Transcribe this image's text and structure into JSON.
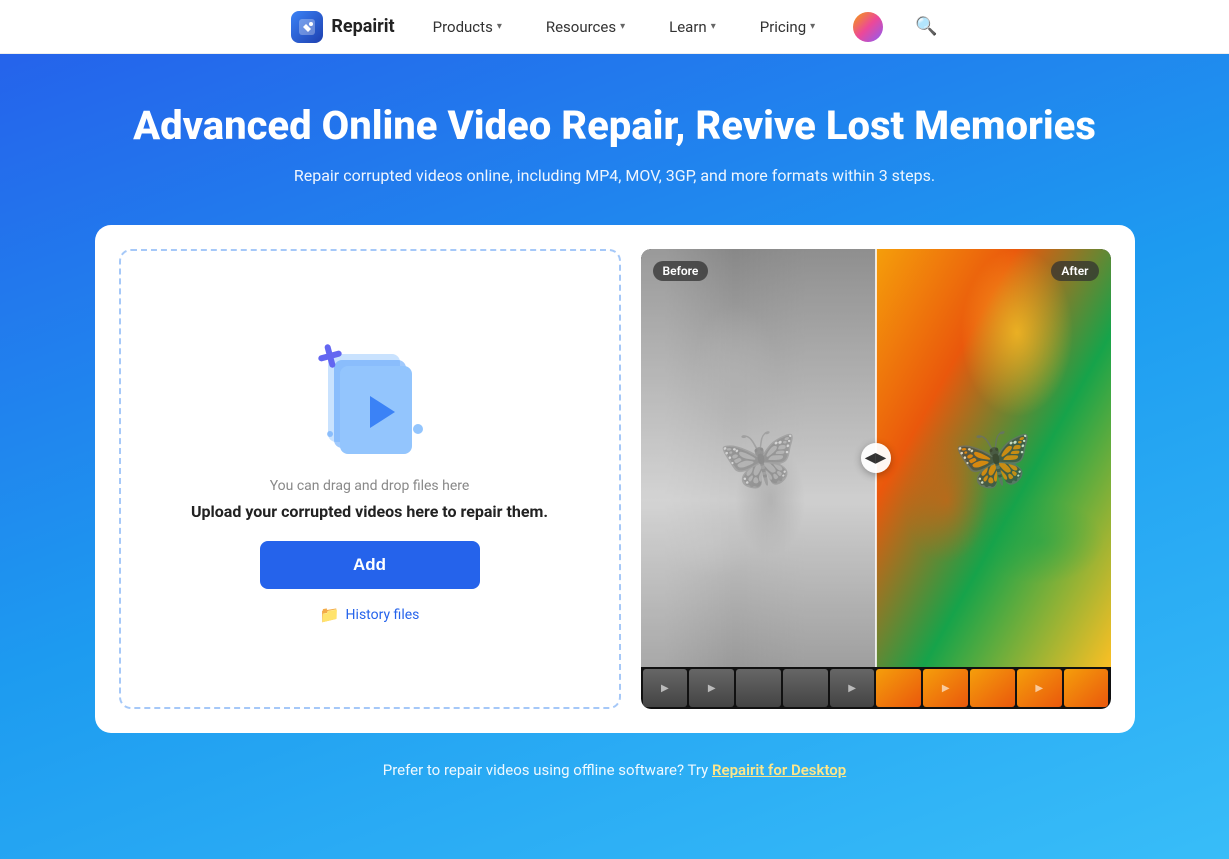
{
  "navbar": {
    "logo_text": "Repairit",
    "products_label": "Products",
    "resources_label": "Resources",
    "learn_label": "Learn",
    "pricing_label": "Pricing"
  },
  "hero": {
    "title": "Advanced Online Video Repair, Revive Lost Memories",
    "subtitle": "Repair corrupted videos online, including MP4, MOV, 3GP, and more formats within 3 steps."
  },
  "upload": {
    "drag_text": "You can drag and drop files here",
    "label": "Upload your corrupted videos here to repair them.",
    "add_button": "Add",
    "history_link": "History files"
  },
  "preview": {
    "badge_before": "Before",
    "badge_after": "After"
  },
  "footer": {
    "text": "Prefer to repair videos using offline software? Try ",
    "link_text": "Repairit for Desktop"
  }
}
